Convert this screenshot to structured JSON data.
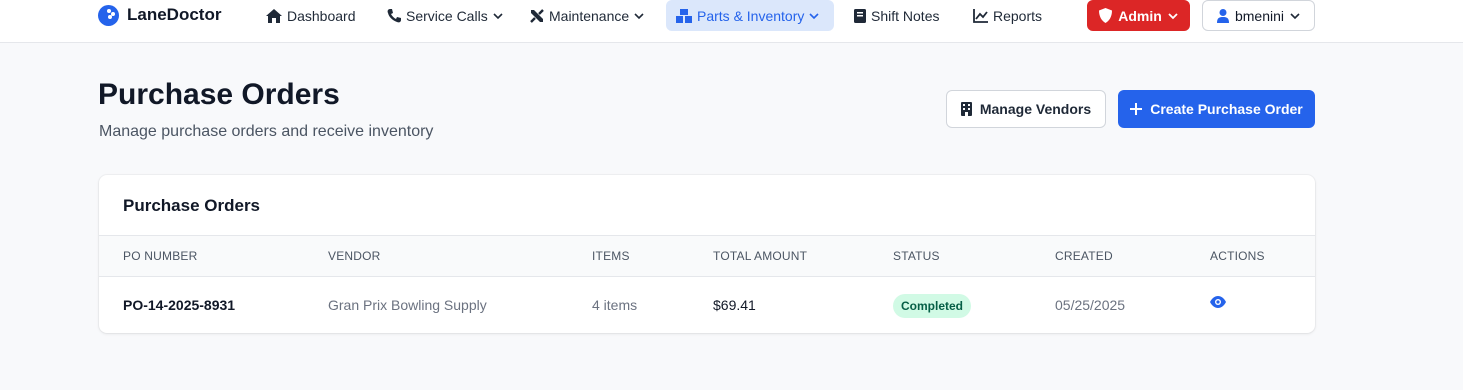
{
  "app": {
    "name": "LaneDoctor"
  },
  "nav": {
    "items": [
      {
        "label": "Dashboard",
        "icon": "home-icon"
      },
      {
        "label": "Service Calls",
        "icon": "phone-icon",
        "dropdown": true
      },
      {
        "label": "Maintenance",
        "icon": "tools-icon",
        "dropdown": true
      },
      {
        "label": "Parts & Inventory",
        "icon": "boxes-icon",
        "dropdown": true,
        "active": true
      },
      {
        "label": "Shift Notes",
        "icon": "book-icon"
      },
      {
        "label": "Reports",
        "icon": "chart-line-icon"
      }
    ],
    "admin_label": "Admin",
    "user_label": "bmenini"
  },
  "header": {
    "title": "Purchase Orders",
    "subtitle": "Manage purchase orders and receive inventory",
    "manage_vendors_label": "Manage Vendors",
    "create_po_label": "Create Purchase Order"
  },
  "table": {
    "title": "Purchase Orders",
    "columns": [
      "PO NUMBER",
      "VENDOR",
      "ITEMS",
      "TOTAL AMOUNT",
      "STATUS",
      "CREATED",
      "ACTIONS"
    ],
    "rows": [
      {
        "po_number": "PO-14-2025-8931",
        "vendor": "Gran Prix Bowling Supply",
        "items": "4 items",
        "total": "$69.41",
        "status": "Completed",
        "created": "05/25/2025",
        "action_icon": "eye-icon"
      }
    ]
  },
  "colors": {
    "primary": "#2563eb",
    "admin": "#dc2626",
    "status_completed_bg": "#d1fae5",
    "status_completed_text": "#065f46"
  }
}
